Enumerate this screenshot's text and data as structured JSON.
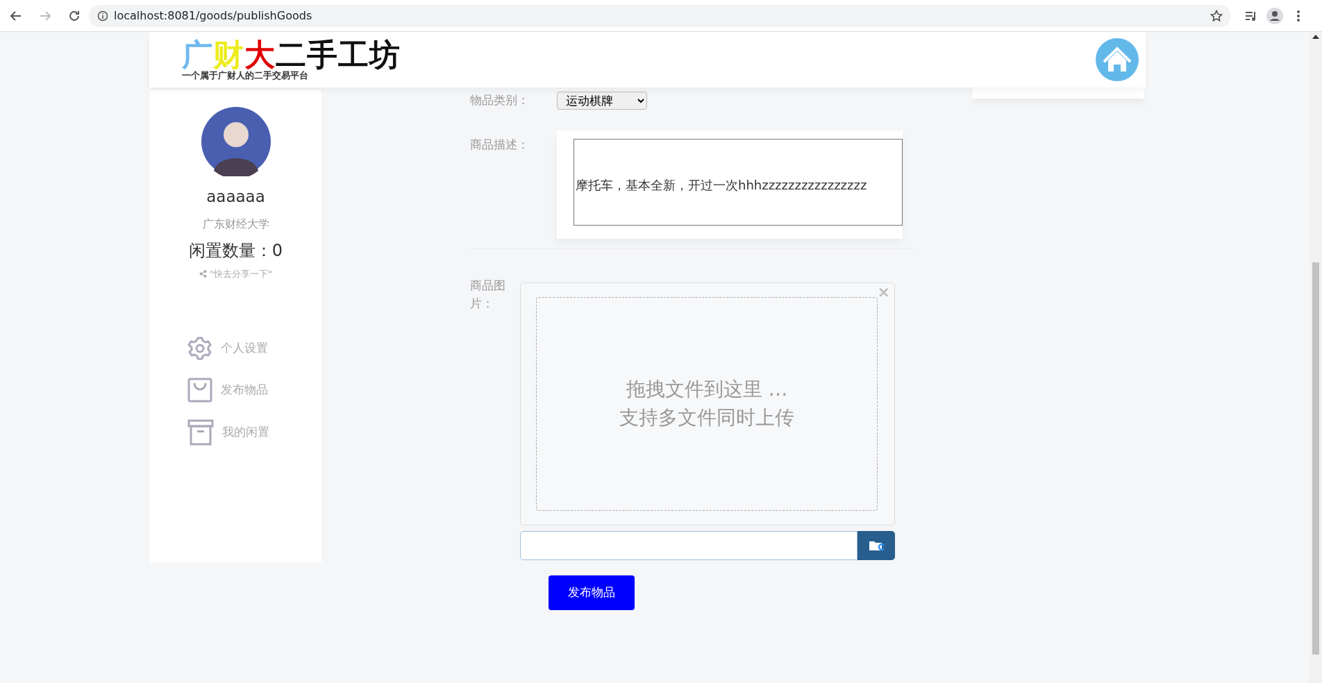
{
  "browser": {
    "url": "localhost:8081/goods/publishGoods"
  },
  "header": {
    "logo": {
      "title_parts": [
        {
          "text": "广",
          "color": "#6cb8f0"
        },
        {
          "text": "财",
          "color": "#ecec1c"
        },
        {
          "text": "大",
          "color": "#e00000"
        },
        {
          "text": "二手工坊",
          "color": "#111111"
        }
      ],
      "tagline": "一个属于广财人的二手交易平台"
    }
  },
  "sidebar": {
    "username": "aaaaaa",
    "school": "广东财经大学",
    "count_label": "闲置数量：",
    "count": "0",
    "share": "\"快去分享一下\"",
    "menu": [
      {
        "kind": "settings",
        "label": "个人设置"
      },
      {
        "kind": "bag",
        "label": "发布物品"
      },
      {
        "kind": "archive",
        "label": "我的闲置"
      }
    ]
  },
  "form": {
    "category": {
      "label": "物品类别：",
      "value": "运动棋牌"
    },
    "description": {
      "label": "商品描述：",
      "value": "摩托车，基本全新，开过一次hhhzzzzzzzzzzzzzzzz"
    },
    "images": {
      "label": "商品图片：",
      "drop_text": "拖拽文件到这里 …",
      "drop_subtext": "支持多文件同时上传",
      "close": "×"
    },
    "submit": "发布物品"
  }
}
